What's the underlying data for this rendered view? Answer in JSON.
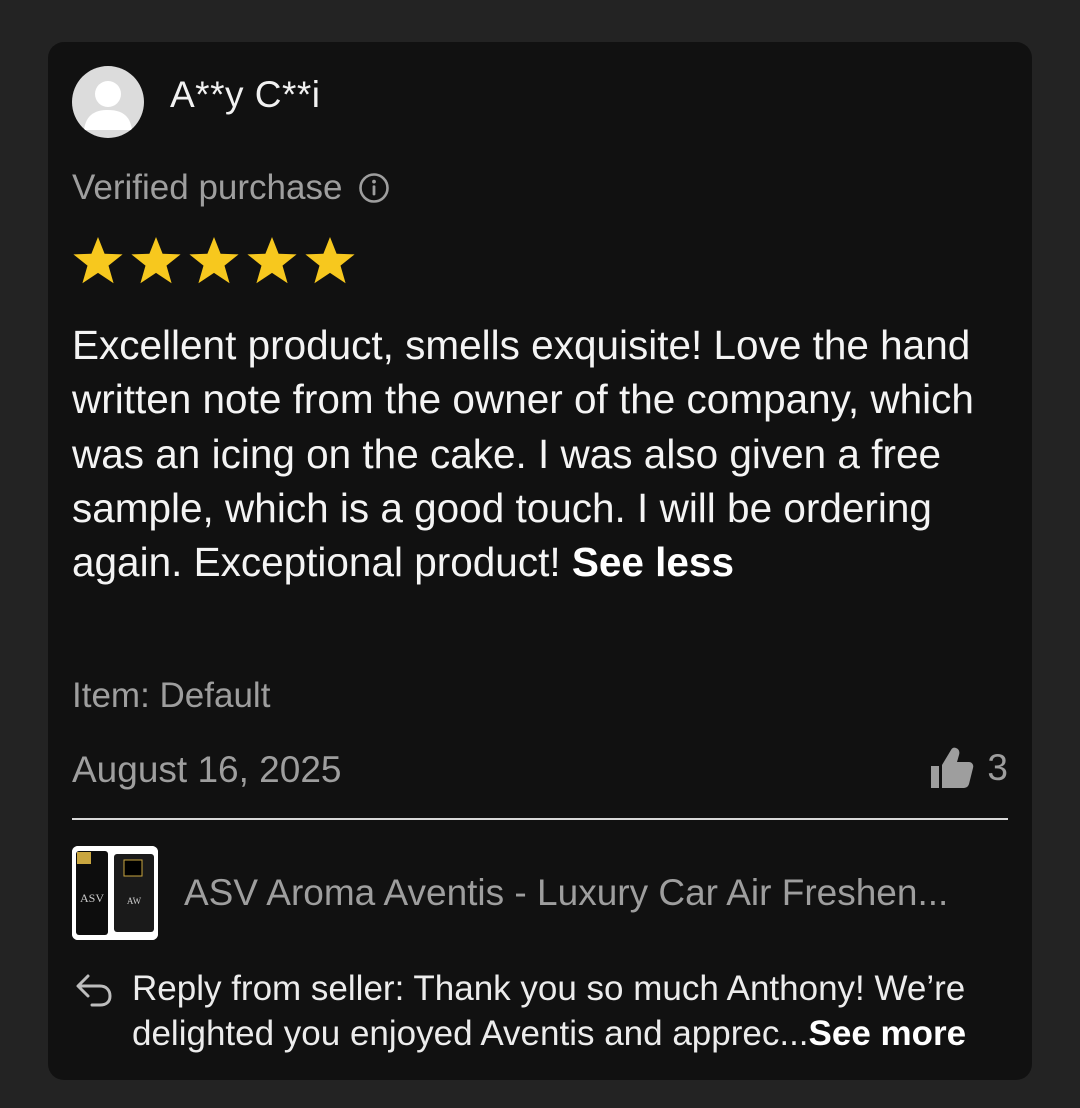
{
  "review": {
    "reviewer_name": "A**y C**i",
    "verified_label": "Verified purchase",
    "rating": 5,
    "star_color": "#F7C81E",
    "body": "Excellent product, smells exquisite! Love the hand written note from the owner of the company, which was an icing on the cake. I was also given a free sample, which is a good touch. I will be ordering again. Exceptional product!",
    "see_less_label": "See less",
    "item_variant": "Item: Default",
    "date": "August 16, 2025",
    "helpful_count": "3"
  },
  "product": {
    "title": "ASV Aroma Aventis - Luxury Car Air Freshen...",
    "thumb_brand_text": "ASV",
    "thumb_brand_text_small": "AW"
  },
  "seller_reply": {
    "text": "Reply from seller: Thank you so much Anthony! We’re delighted you enjoyed Aventis and apprec...",
    "see_more_label": "See more"
  },
  "icons": {
    "avatar": "default-user-avatar",
    "info": "info-circle-icon",
    "star": "star-icon",
    "helpful": "thumbs-up-icon",
    "reply": "reply-arrow-icon"
  }
}
